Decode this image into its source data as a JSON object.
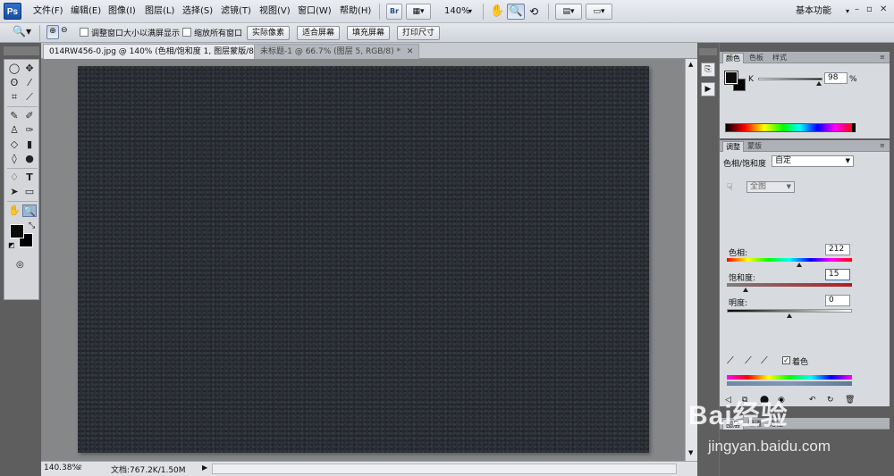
{
  "app": {
    "logo": "Ps"
  },
  "menubar": {
    "items": [
      "文件(F)",
      "编辑(E)",
      "图像(I)",
      "图层(L)",
      "选择(S)",
      "滤镜(T)",
      "视图(V)",
      "窗口(W)",
      "帮助(H)"
    ],
    "zoom": "140%",
    "workspace": "基本功能"
  },
  "options": {
    "resize_windows_label": "调整窗口大小以满屏显示",
    "zoom_all_windows_label": "缩放所有窗口",
    "actual_pixels": "实际像素",
    "fit_screen": "适合屏幕",
    "fill_screen": "填充屏幕",
    "print_size": "打印尺寸"
  },
  "document": {
    "tabs": [
      {
        "label": "014RW456-0.jpg @ 140% (色相/饱和度 1, 图层蒙版/8) *",
        "active": true
      },
      {
        "label": "未标题-1 @ 66.7% (图层 5, RGB/8) *",
        "active": false
      }
    ],
    "canvas_color": "#2a2d34",
    "status_zoom": "140.38%",
    "status_doc": "文档:767.2K/1.50M"
  },
  "panels": {
    "color": {
      "tabs": [
        "颜色",
        "色板",
        "样式"
      ],
      "channel_label": "K",
      "value": "98",
      "unit": "%"
    },
    "adjustments": {
      "tabs": [
        "调整",
        "蒙版"
      ],
      "title": "色相/饱和度",
      "preset": "自定",
      "range": "全图",
      "hue_label": "色相:",
      "hue_value": "212",
      "saturation_label": "饱和度:",
      "saturation_value": "15",
      "lightness_label": "明度:",
      "lightness_value": "0",
      "colorize_label": "着色",
      "colorize_checked": true
    },
    "layers": {
      "tabs": [
        "图层",
        "通道",
        "路径"
      ]
    }
  },
  "watermark": {
    "brand": "Bai经验",
    "url": "jingyan.baidu.com"
  }
}
